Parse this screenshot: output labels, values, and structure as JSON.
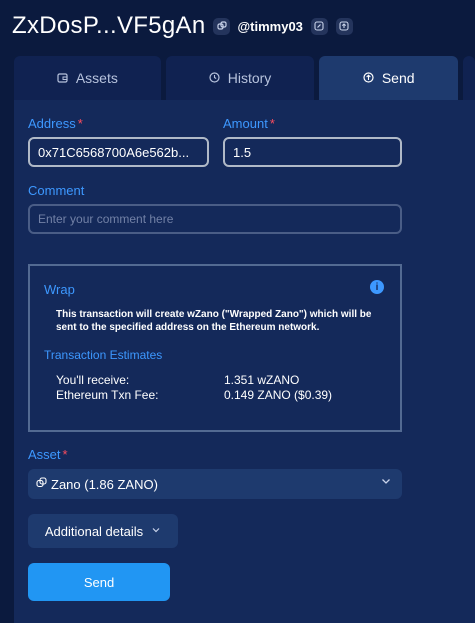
{
  "header": {
    "wallet_name": "ZxDosP...VF5gAn",
    "alias": "@timmy03",
    "copy_icon": "copy-icon",
    "edit_icon": "edit-icon",
    "export_icon": "export-icon"
  },
  "tabs": [
    {
      "label": "Assets",
      "icon": "wallet-icon"
    },
    {
      "label": "History",
      "icon": "clock-icon"
    },
    {
      "label": "Send",
      "icon": "upload-icon",
      "active": true
    }
  ],
  "form": {
    "address_label": "Address",
    "address_value": "0x71C6568700A6e562b...",
    "amount_label": "Amount",
    "amount_value": "1.5",
    "required_mark": "*",
    "comment_label": "Comment",
    "comment_placeholder": "Enter your comment here"
  },
  "wrap": {
    "title": "Wrap",
    "text": "This transaction will create wZano (\"Wrapped Zano\") which will be sent to the specified address on the Ethereum network.",
    "estimates_title": "Transaction Estimates",
    "receive_label": "You'll receive:",
    "receive_value": "1.351 wZANO",
    "fee_label": "Ethereum Txn Fee:",
    "fee_value": "0.149 ZANO ($0.39)"
  },
  "asset": {
    "label": "Asset",
    "selected": "Zano (1.86 ZANO)"
  },
  "buttons": {
    "additional_details": "Additional details",
    "send": "Send"
  },
  "colors": {
    "accent": "#3d98ff",
    "required": "#ff4d5e",
    "primary_button": "#2196f3",
    "background": "#0b1a3e"
  }
}
